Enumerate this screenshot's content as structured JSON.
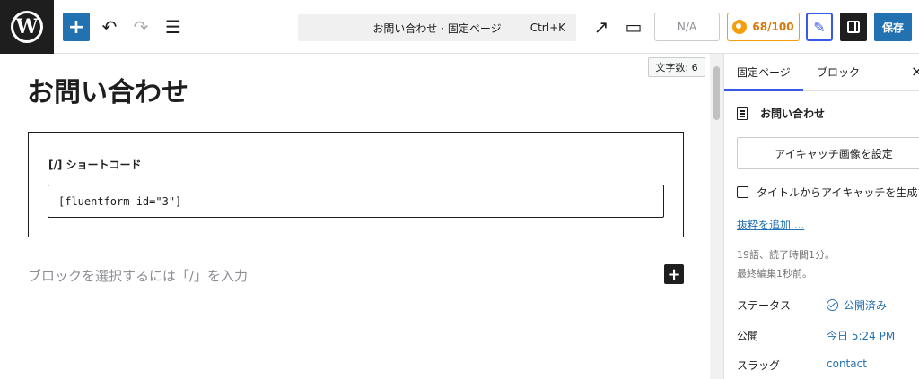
{
  "toolbar": {
    "logo": "W",
    "add_icon": "+",
    "undo_icon": "↶",
    "redo_icon": "↷",
    "list_view_icon": "☰",
    "document_title": "お問い合わせ · 固定ページ",
    "shortcut": "Ctrl+K",
    "external_icon": "↗",
    "preview_icon": "▭",
    "na_label": "N/A",
    "score_label": "68/100",
    "magic_icon": "✎",
    "save_label": "保存"
  },
  "editor": {
    "word_count": "文字数: 6",
    "page_title": "お問い合わせ",
    "shortcode_label": "[/] ショートコード",
    "shortcode_value": "[fluentform id=\"3\"]",
    "block_placeholder": "ブロックを選択するには「/」を入力",
    "block_add_icon": "+"
  },
  "sidebar": {
    "tab_page": "固定ページ",
    "tab_block": "ブロック",
    "close_icon": "×",
    "doc_title": "お問い合わせ",
    "more_icon": "⋮",
    "featured_button": "アイキャッチ画像を設定",
    "generate_featured": "タイトルからアイキャッチを生成する",
    "add_excerpt": "抜粋を追加 ...",
    "meta_words": "19語、読了時間1分。",
    "meta_edited": "最終編集1秒前。",
    "status_label": "ステータス",
    "status_value": "公開済み",
    "publish_label": "公開",
    "publish_value": "今日 5:24 PM",
    "slug_label": "スラッグ",
    "slug_value": "contact"
  }
}
